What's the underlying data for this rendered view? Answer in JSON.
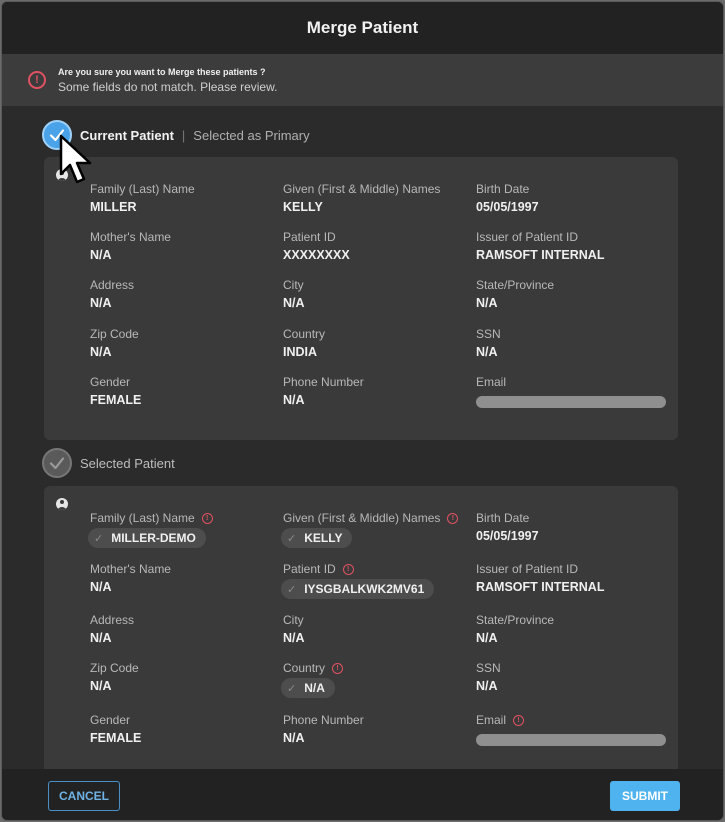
{
  "dialog": {
    "title": "Merge Patient",
    "warning": {
      "title": "Are you sure you want to Merge these patients ?",
      "subtitle": "Some fields do not match. Please review.",
      "icon": "alert-circle-icon"
    }
  },
  "current": {
    "label": "Current Patient",
    "sublabel": "Selected as Primary",
    "checked": true,
    "fields": {
      "family_name": {
        "label": "Family (Last) Name",
        "value": "MILLER"
      },
      "given_name": {
        "label": "Given (First & Middle) Names",
        "value": "KELLY"
      },
      "birth_date": {
        "label": "Birth Date",
        "value": "05/05/1997"
      },
      "mother_name": {
        "label": "Mother's Name",
        "value": "N/A"
      },
      "patient_id": {
        "label": "Patient ID",
        "value": "XXXXXXXX"
      },
      "issuer": {
        "label": "Issuer of Patient ID",
        "value": "RAMSOFT INTERNAL"
      },
      "address": {
        "label": "Address",
        "value": "N/A"
      },
      "city": {
        "label": "City",
        "value": "N/A"
      },
      "state": {
        "label": "State/Province",
        "value": "N/A"
      },
      "zip": {
        "label": "Zip Code",
        "value": "N/A"
      },
      "country": {
        "label": "Country",
        "value": "INDIA"
      },
      "ssn": {
        "label": "SSN",
        "value": "N/A"
      },
      "gender": {
        "label": "Gender",
        "value": "FEMALE"
      },
      "phone": {
        "label": "Phone Number",
        "value": "N/A"
      },
      "email": {
        "label": "Email",
        "value": ""
      }
    }
  },
  "selected": {
    "label": "Selected Patient",
    "checked": false,
    "fields": {
      "family_name": {
        "label": "Family (Last) Name",
        "value": "MILLER-DEMO",
        "mismatch": true
      },
      "given_name": {
        "label": "Given (First & Middle) Names",
        "value": "KELLY",
        "mismatch": true
      },
      "birth_date": {
        "label": "Birth Date",
        "value": "05/05/1997"
      },
      "mother_name": {
        "label": "Mother's Name",
        "value": "N/A"
      },
      "patient_id": {
        "label": "Patient ID",
        "value": "IYSGBALKWK2MV61",
        "mismatch": true
      },
      "issuer": {
        "label": "Issuer of Patient ID",
        "value": "RAMSOFT INTERNAL"
      },
      "address": {
        "label": "Address",
        "value": "N/A"
      },
      "city": {
        "label": "City",
        "value": "N/A"
      },
      "state": {
        "label": "State/Province",
        "value": "N/A"
      },
      "zip": {
        "label": "Zip Code",
        "value": "N/A"
      },
      "country": {
        "label": "Country",
        "value": "N/A",
        "mismatch": true
      },
      "ssn": {
        "label": "SSN",
        "value": "N/A"
      },
      "gender": {
        "label": "Gender",
        "value": "FEMALE"
      },
      "phone": {
        "label": "Phone Number",
        "value": "N/A"
      },
      "email": {
        "label": "Email",
        "value": "",
        "mismatch": true
      }
    }
  },
  "footer": {
    "cancel_label": "CANCEL",
    "submit_label": "SUBMIT"
  },
  "colors": {
    "accent": "#4fb3f0",
    "alert": "#e05262",
    "card_bg": "#3a3a3a",
    "dialog_bg": "#2b2b2b"
  }
}
